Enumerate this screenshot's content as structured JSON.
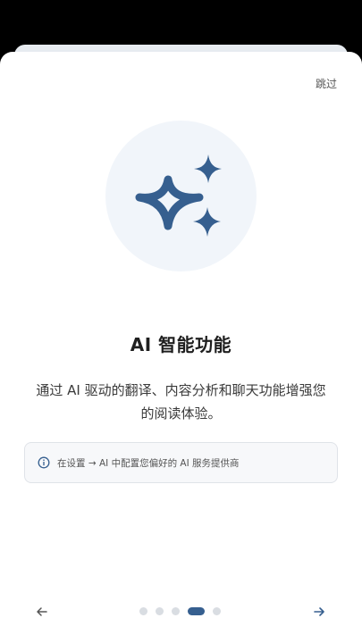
{
  "header": {
    "skip_label": "跳过"
  },
  "hero": {
    "icon": "sparkles-icon",
    "accent_color": "#365f8f",
    "circle_color": "#f1f5fa"
  },
  "main": {
    "title": "AI 智能功能",
    "description_line1": "通过 AI 驱动的翻译、内容分析和聊天功能增强您",
    "description_line2": "的阅读体验。"
  },
  "info": {
    "icon": "info-icon",
    "text": "在设置 → AI 中配置您偏好的 AI 服务提供商"
  },
  "navigation": {
    "prev_icon": "arrow-left-icon",
    "next_icon": "arrow-right-icon",
    "page_count": 5,
    "active_page": 4
  }
}
